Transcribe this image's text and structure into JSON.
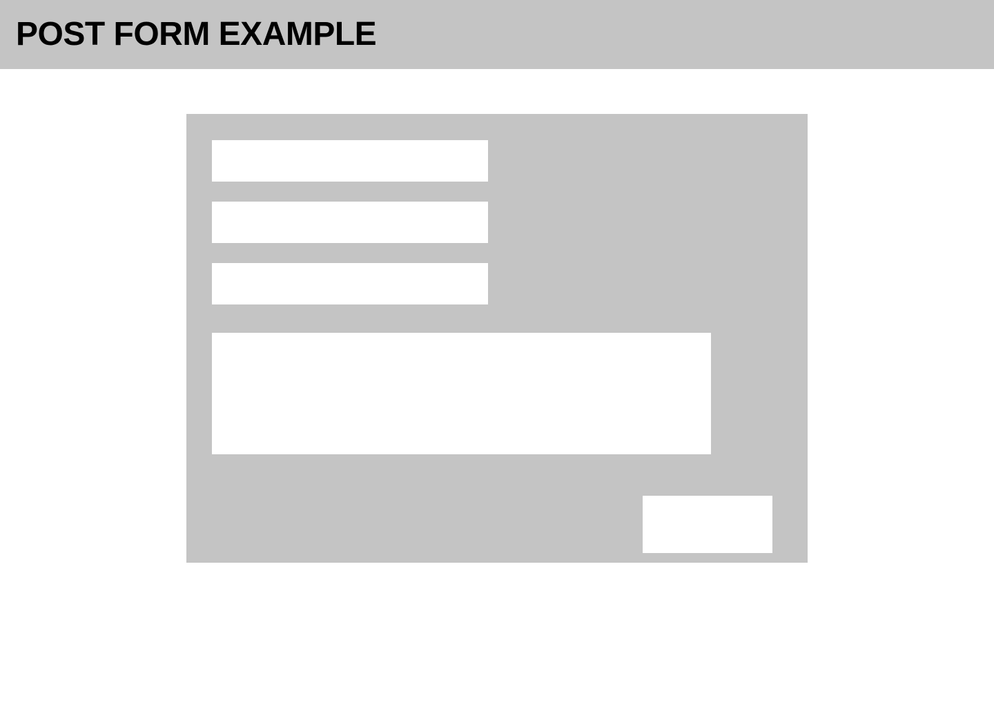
{
  "header": {
    "title": "POST FORM EXAMPLE",
    "background_color": "#c4c4c4"
  },
  "form": {
    "background_color": "#c4c4c4",
    "field_color": "#ffffff",
    "fields": [
      {
        "value": "",
        "placeholder": ""
      },
      {
        "value": "",
        "placeholder": ""
      },
      {
        "value": "",
        "placeholder": ""
      }
    ],
    "message": {
      "value": "",
      "placeholder": ""
    },
    "submit_label": ""
  }
}
